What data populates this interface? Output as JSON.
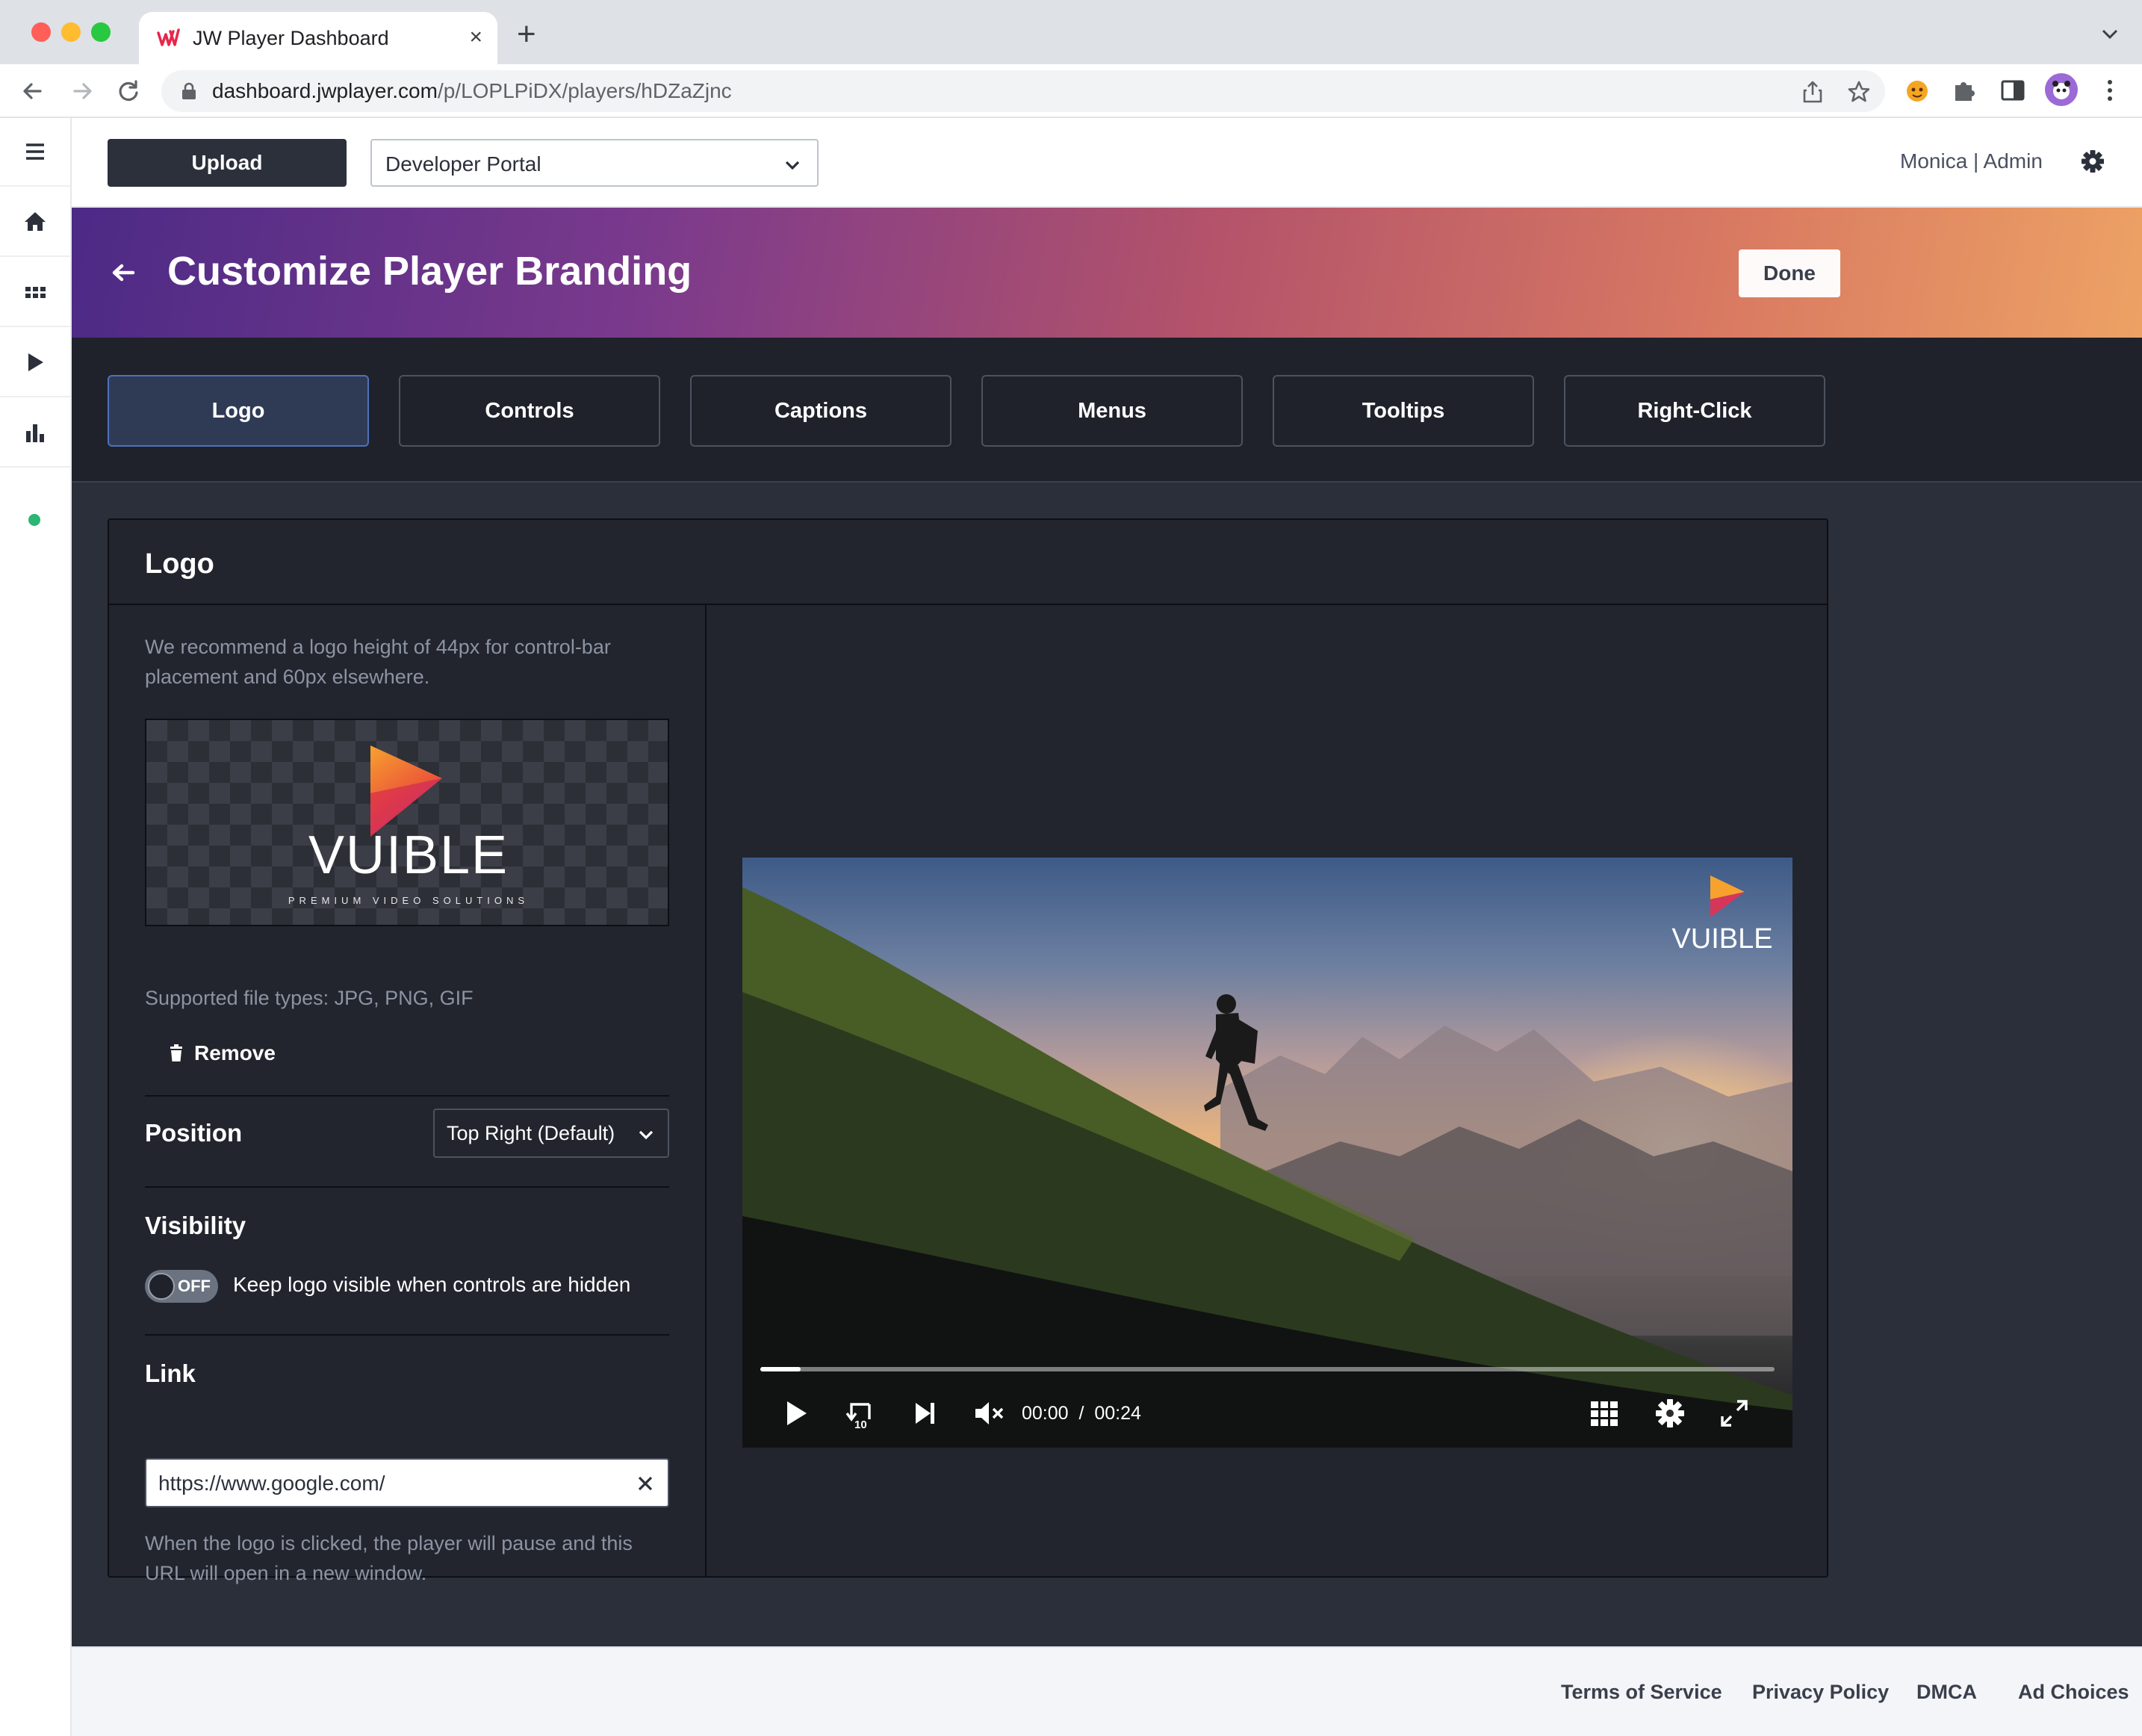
{
  "browser": {
    "tab_title": "JW Player Dashboard",
    "new_tab_glyph": "+",
    "close_glyph": "×",
    "url_host": "dashboard.jwplayer.com",
    "url_path": "/p/LOPLPiDX/players/hDZaZjnc"
  },
  "header": {
    "upload_label": "Upload",
    "property_selected": "Developer Portal",
    "user_label": "Monica | Admin"
  },
  "banner": {
    "title": "Customize Player Branding",
    "done_label": "Done",
    "gradient": [
      "#4c2a86",
      "#b4536a",
      "#eda264"
    ]
  },
  "tabs": [
    {
      "label": "Logo",
      "active": true
    },
    {
      "label": "Controls"
    },
    {
      "label": "Captions"
    },
    {
      "label": "Menus"
    },
    {
      "label": "Tooltips"
    },
    {
      "label": "Right-Click"
    }
  ],
  "logo_panel": {
    "title": "Logo",
    "recommend_hint": "We recommend a logo height of 44px for control-bar placement and 60px elsewhere.",
    "logo_word": "VUIBLE",
    "logo_tagline": "PREMIUM VIDEO SOLUTIONS",
    "file_types": "Supported file types: JPG, PNG, GIF",
    "remove_label": "Remove",
    "position_label": "Position",
    "position_value": "Top Right (Default)",
    "visibility_label": "Visibility",
    "toggle_state": "OFF",
    "toggle_text": "Keep logo visible when controls are hidden",
    "link_label": "Link",
    "link_value": "https://www.google.com/",
    "link_hint": "When the logo is clicked, the player will pause and this URL will open in a new window."
  },
  "player": {
    "current_time": "00:00",
    "separator": "/",
    "duration": "00:24",
    "progress_fraction": 0.04,
    "logo_word": "VUIBLE"
  },
  "footer": {
    "links": [
      "Terms of Service",
      "Privacy Policy",
      "DMCA",
      "Ad Choices"
    ]
  },
  "icons": [
    "menu-icon",
    "home-icon",
    "apps-icon",
    "play-icon",
    "analytics-icon",
    "gear-icon",
    "back-arrow-icon",
    "trash-icon",
    "chevron-down-icon",
    "clear-icon",
    "rewind-10-icon",
    "next-icon",
    "mute-icon",
    "grid-icon",
    "fullscreen-icon"
  ]
}
